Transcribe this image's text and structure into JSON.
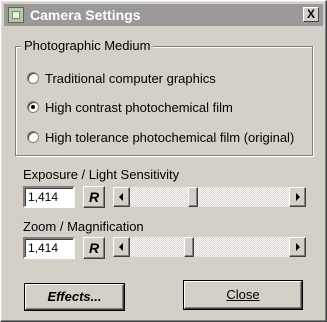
{
  "window": {
    "title": "Camera Settings",
    "close_glyph": "X"
  },
  "medium": {
    "label": "Photographic Medium",
    "options": [
      {
        "label": "Traditional computer graphics",
        "checked": false
      },
      {
        "label": "High contrast photochemical film",
        "checked": true
      },
      {
        "label": "High tolerance photochemical film (original)",
        "checked": false
      }
    ]
  },
  "exposure": {
    "label": "Exposure / Light Sensitivity",
    "value": "1,414",
    "reset_label": "R"
  },
  "zoom": {
    "label": "Zoom / Magnification",
    "value": "1,414",
    "reset_label": "R"
  },
  "buttons": {
    "effects_label": "Effects...",
    "close_label": "Close"
  },
  "icons": {
    "app": "camera-settings-icon",
    "scroll_left": "scroll-left-arrow-icon",
    "scroll_right": "scroll-right-arrow-icon"
  },
  "colors": {
    "title_bar": "#9a9898",
    "face": "#d4d0c8"
  }
}
